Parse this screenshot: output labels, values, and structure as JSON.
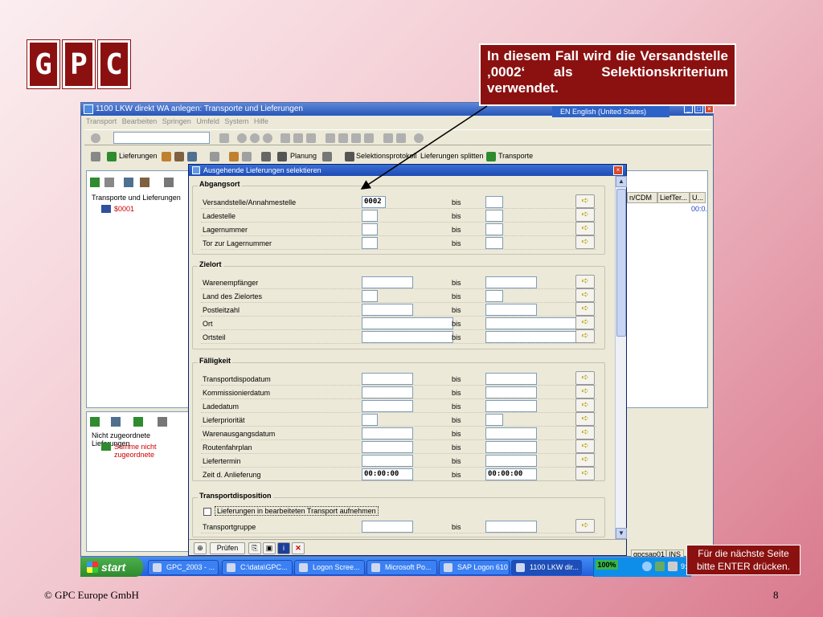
{
  "logo": {
    "letters": [
      "G",
      "P",
      "C"
    ]
  },
  "callout_top": "In diesem Fall wird die Versandstelle ‚0002‘ als Selektionskriterium verwendet.",
  "callout_bottom": "Für die nächste Seite bitte ENTER drücken.",
  "footer": {
    "copyright": "© GPC Europe GmbH",
    "page": "8"
  },
  "sap": {
    "title": "1100 LKW direkt WA  anlegen: Transporte und Lieferungen",
    "menu": [
      "Transport",
      "Bearbeiten",
      "Springen",
      "Umfeld",
      "System",
      "Hilfe"
    ],
    "language": "EN English (United States)",
    "toolbar2": [
      "Lieferungen",
      "Planung",
      "Selektionsprotokoll",
      "Lieferungen splitten",
      "Transporte"
    ],
    "left_tree_title": "Transporte und Lieferungen",
    "left_tree_item": "$0001",
    "left2_title": "Nicht zugeordnete Lieferungen",
    "left2_item": "Summe nicht zugeordnete",
    "right_headers": [
      "n/CDM",
      "LiefTer...",
      "U..."
    ],
    "right_value": "00:0.",
    "status": [
      "gpcsap01",
      "INS"
    ]
  },
  "dialog": {
    "title": "Ausgehende Lieferungen selektieren",
    "bis_label": "bis",
    "groups": [
      {
        "label": "Abgangsort",
        "rows": [
          {
            "label": "Versandstelle/Annahmestelle",
            "from": "0002",
            "to": ""
          },
          {
            "label": "Ladestelle",
            "from": "",
            "to": ""
          },
          {
            "label": "Lagernummer",
            "from": "",
            "to": ""
          },
          {
            "label": "Tor zur Lagernummer",
            "from": "",
            "to": ""
          }
        ]
      },
      {
        "label": "Zielort",
        "rows": [
          {
            "label": "Warenempfänger",
            "from": "",
            "to": ""
          },
          {
            "label": "Land des Zielortes",
            "from": "",
            "to": ""
          },
          {
            "label": "Postleitzahl",
            "from": "",
            "to": ""
          },
          {
            "label": "Ort",
            "from": "",
            "to": ""
          },
          {
            "label": "Ortsteil",
            "from": "",
            "to": ""
          }
        ]
      },
      {
        "label": "Fälligkeit",
        "rows": [
          {
            "label": "Transportdispodatum",
            "from": "",
            "to": ""
          },
          {
            "label": "Kommissionierdatum",
            "from": "",
            "to": ""
          },
          {
            "label": "Ladedatum",
            "from": "",
            "to": ""
          },
          {
            "label": "Lieferpriorität",
            "from": "",
            "to": ""
          },
          {
            "label": "Warenausgangsdatum",
            "from": "",
            "to": ""
          },
          {
            "label": "Routenfahrplan",
            "from": "",
            "to": ""
          },
          {
            "label": "Liefertermin",
            "from": "",
            "to": ""
          },
          {
            "label": "Zeit d. Anlieferung",
            "from": "00:00:00",
            "to": "00:00:00"
          }
        ]
      },
      {
        "label": "Transportdisposition",
        "rows": [
          {
            "label": "Transportgruppe",
            "from": "",
            "to": ""
          }
        ]
      }
    ],
    "checkbox_label": "Lieferungen in bearbeiteten Transport aufnehmen",
    "footer_buttons": {
      "check": "Prüfen"
    }
  },
  "taskbar": {
    "start": "start",
    "tasks": [
      "GPC_2003 - ...",
      "C:\\data\\GPC...",
      "Logon Scree...",
      "Microsoft Po...",
      "SAP Logon 610",
      "1100 LKW dir..."
    ],
    "battery": "100%",
    "clock": "9:"
  }
}
